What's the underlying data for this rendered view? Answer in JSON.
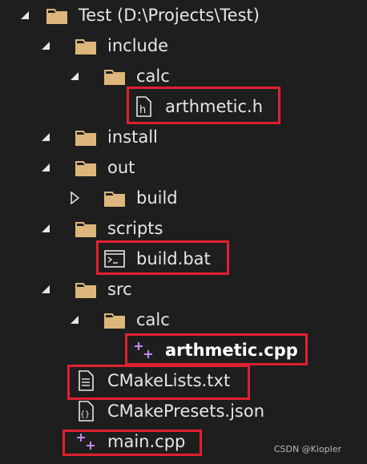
{
  "tree": {
    "root": {
      "label": "Test (D:\\Projects\\Test)"
    },
    "include": {
      "label": "include"
    },
    "include_calc": {
      "label": "calc"
    },
    "arthmetic_h": {
      "label": "arthmetic.h"
    },
    "install": {
      "label": "install"
    },
    "out": {
      "label": "out"
    },
    "out_build": {
      "label": "build"
    },
    "scripts": {
      "label": "scripts"
    },
    "build_bat": {
      "label": "build.bat"
    },
    "src": {
      "label": "src"
    },
    "src_calc": {
      "label": "calc"
    },
    "arthmetic_cpp": {
      "label": "arthmetic.cpp"
    },
    "cmakelists": {
      "label": "CMakeLists.txt"
    },
    "cmakepresets": {
      "label": "CMakePresets.json"
    },
    "main_cpp": {
      "label": "main.cpp"
    }
  },
  "watermark": "CSDN @Kiopler",
  "colors": {
    "background": "#1e1e1e",
    "folder": "#dcb67a",
    "highlight": "#e02030",
    "cpp_icon": "#c586f6"
  }
}
